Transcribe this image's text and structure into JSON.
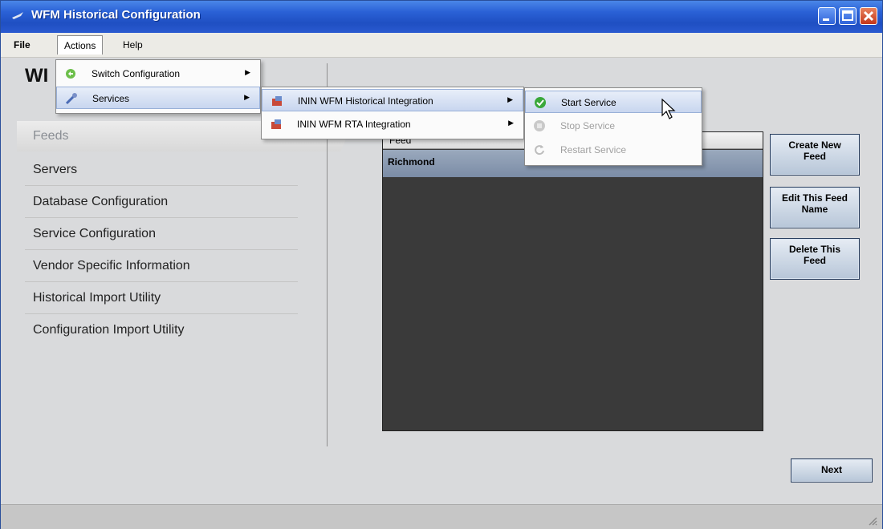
{
  "window": {
    "title": "WFM Historical Configuration"
  },
  "menubar": {
    "items": [
      "File",
      "Actions",
      "Help"
    ]
  },
  "panel": {
    "header": "WI"
  },
  "nav": {
    "items": [
      {
        "label": "Feeds",
        "active": true
      },
      {
        "label": "Servers",
        "active": false
      },
      {
        "label": "Database Configuration",
        "active": false
      },
      {
        "label": "Service Configuration",
        "active": false
      },
      {
        "label": "Vendor Specific Information",
        "active": false
      },
      {
        "label": "Historical Import Utility",
        "active": false
      },
      {
        "label": "Configuration Import Utility",
        "active": false
      }
    ]
  },
  "feed_list": {
    "column_header": "Feed",
    "rows": [
      "Richmond"
    ]
  },
  "buttons": {
    "create_new_feed": [
      "Create New",
      "Feed"
    ],
    "edit_feed_name": [
      "Edit This Feed",
      "Name"
    ],
    "delete_feed": [
      "Delete This",
      "Feed"
    ],
    "next": "Next"
  },
  "actions_menu": {
    "items": [
      {
        "label": "Switch Configuration",
        "icon": "switch-config-icon",
        "submenu": true,
        "highlighted": false
      },
      {
        "label": "Services",
        "icon": "services-icon",
        "submenu": true,
        "highlighted": true
      }
    ]
  },
  "services_submenu": {
    "items": [
      {
        "label": "ININ WFM Historical Integration",
        "icon": "service-icon",
        "submenu": true,
        "highlighted": true
      },
      {
        "label": "ININ WFM RTA Integration",
        "icon": "service-icon",
        "submenu": true,
        "highlighted": false
      }
    ]
  },
  "service_actions_submenu": {
    "items": [
      {
        "label": "Start Service",
        "icon": "start-check-icon",
        "enabled": true,
        "highlighted": true
      },
      {
        "label": "Stop Service",
        "icon": "stop-icon",
        "enabled": false,
        "highlighted": false
      },
      {
        "label": "Restart Service",
        "icon": "restart-icon",
        "enabled": false,
        "highlighted": false
      }
    ]
  },
  "colors": {
    "titlebar": "#2a61d6",
    "selection": "#8a9ab2",
    "list_background": "#3a3a3a"
  }
}
